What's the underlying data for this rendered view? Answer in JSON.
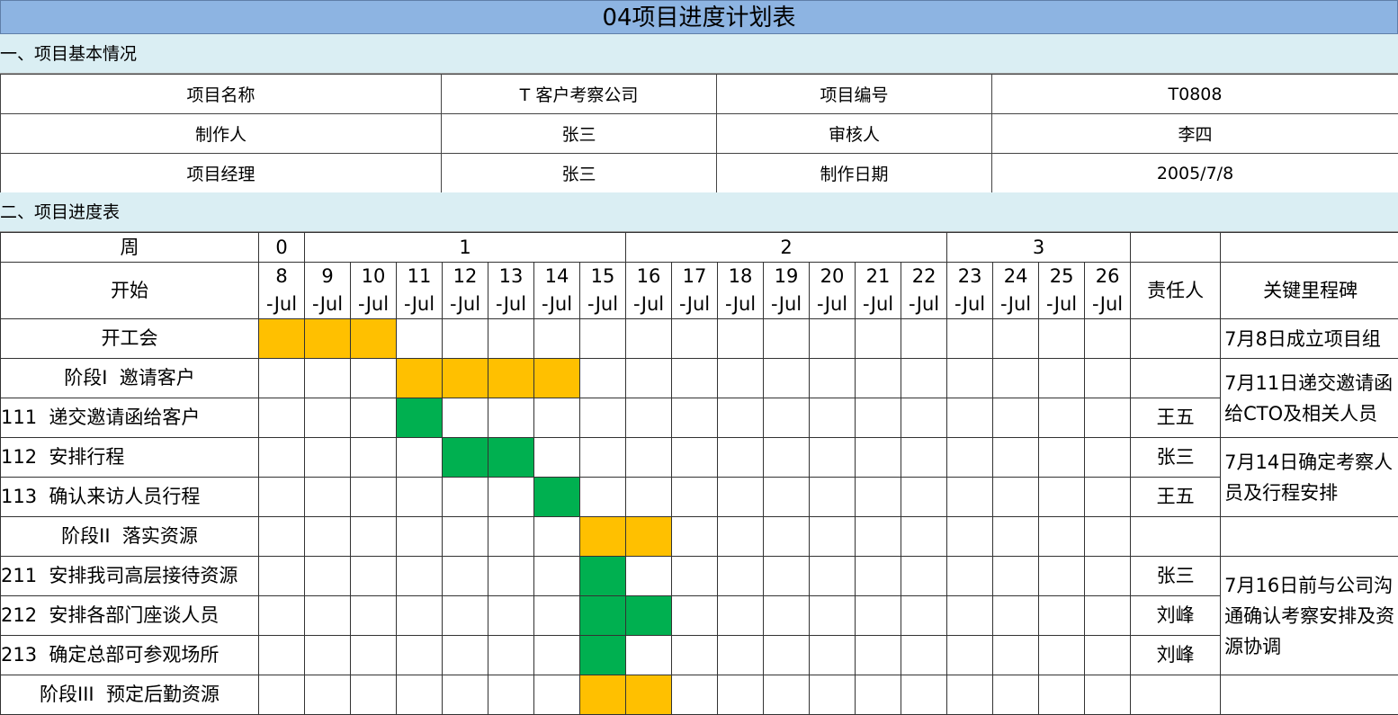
{
  "title": "04项目进度计划表",
  "section1": "一、项目基本情况",
  "section2": "二、项目进度表",
  "info": {
    "r1": [
      "项目名称",
      "T 客户考察公司",
      "项目编号",
      "T0808"
    ],
    "r2": [
      "制作人",
      "张三",
      "审核人",
      "李四"
    ],
    "r3": [
      "项目经理",
      "张三",
      "制作日期",
      "2005/7/8"
    ]
  },
  "gantt": {
    "week_label": "周",
    "start_label": "开始",
    "owner_header": "责任人",
    "milestone_header": "关键里程碑",
    "weeks": [
      "0",
      "1",
      "2",
      "3"
    ],
    "days": [
      "8",
      "9",
      "10",
      "11",
      "12",
      "13",
      "14",
      "15",
      "16",
      "17",
      "18",
      "19",
      "20",
      "21",
      "22",
      "23",
      "24",
      "25",
      "26"
    ],
    "month_suffix": "-Jul",
    "colors": {
      "phase": "#ffc000",
      "task": "#00b050"
    },
    "tasks": [
      {
        "name": "开工会",
        "align": "center",
        "owner": "",
        "bar": [
          0,
          2
        ],
        "type": "phase"
      },
      {
        "name": "阶段I  邀请客户",
        "align": "center",
        "owner": "",
        "bar": [
          3,
          6
        ],
        "type": "phase"
      },
      {
        "name": "111  递交邀请函给客户",
        "align": "left",
        "owner": "王五",
        "bar": [
          3,
          3
        ],
        "type": "task"
      },
      {
        "name": "112  安排行程",
        "align": "left",
        "owner": "张三",
        "bar": [
          4,
          5
        ],
        "type": "task"
      },
      {
        "name": "113  确认来访人员行程",
        "align": "left",
        "owner": "王五",
        "bar": [
          6,
          6
        ],
        "type": "task"
      },
      {
        "name": "阶段II  落实资源",
        "align": "center",
        "owner": "",
        "bar": [
          7,
          8
        ],
        "type": "phase"
      },
      {
        "name": "211  安排我司高层接待资源",
        "align": "left",
        "owner": "张三",
        "bar": [
          7,
          7
        ],
        "type": "task"
      },
      {
        "name": "212  安排各部门座谈人员",
        "align": "left",
        "owner": "刘峰",
        "bar": [
          7,
          8
        ],
        "type": "task"
      },
      {
        "name": "213  确定总部可参观场所",
        "align": "left",
        "owner": "刘峰",
        "bar": [
          7,
          7
        ],
        "type": "task"
      },
      {
        "name": "阶段III  预定后勤资源",
        "align": "center",
        "owner": "",
        "bar": [
          7,
          8
        ],
        "type": "phase"
      }
    ],
    "milestones": [
      {
        "row": 0,
        "span": 1,
        "text": "7月8日成立项目组"
      },
      {
        "row": 1,
        "span": 2,
        "text": "7月11日递交邀请函给CTO及相关人员"
      },
      {
        "row": 3,
        "span": 2,
        "text": "7月14日确定考察人员及行程安排"
      },
      {
        "row": 5,
        "span": 1,
        "text": ""
      },
      {
        "row": 6,
        "span": 3,
        "text": "7月16日前与公司沟通确认考察安排及资源协调"
      },
      {
        "row": 9,
        "span": 1,
        "text": ""
      }
    ]
  }
}
